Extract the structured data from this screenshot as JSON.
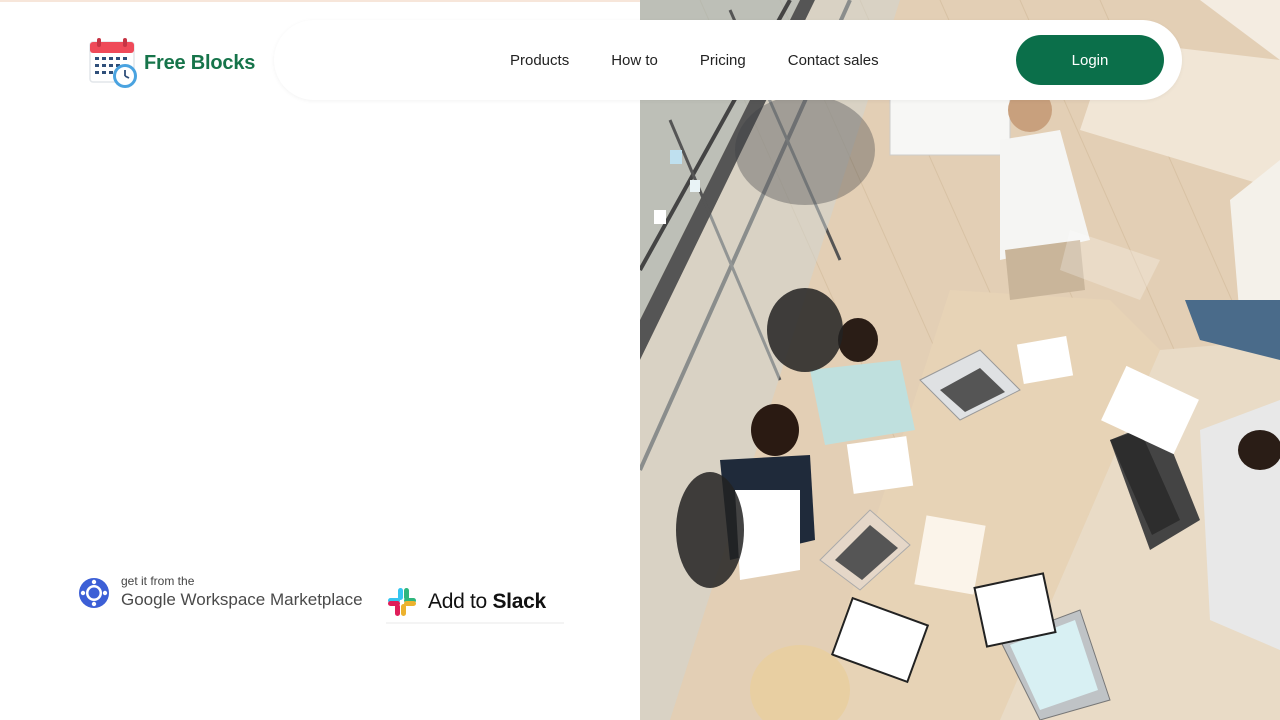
{
  "brand": {
    "name": "Free Blocks",
    "color": "#16744a",
    "icon": "calendar-clock-icon"
  },
  "nav": {
    "links": [
      "Products",
      "How to",
      "Pricing",
      "Contact sales"
    ],
    "login_label": "Login",
    "login_color": "#0b6f4a"
  },
  "badges": {
    "google": {
      "small": "get it from the",
      "big": "Google Workspace Marketplace",
      "icon": "google-workspace-icon"
    },
    "slack": {
      "prefix": "Add to ",
      "name": "Slack",
      "icon": "slack-icon"
    }
  },
  "hero": {
    "image": "office-team-photo"
  }
}
